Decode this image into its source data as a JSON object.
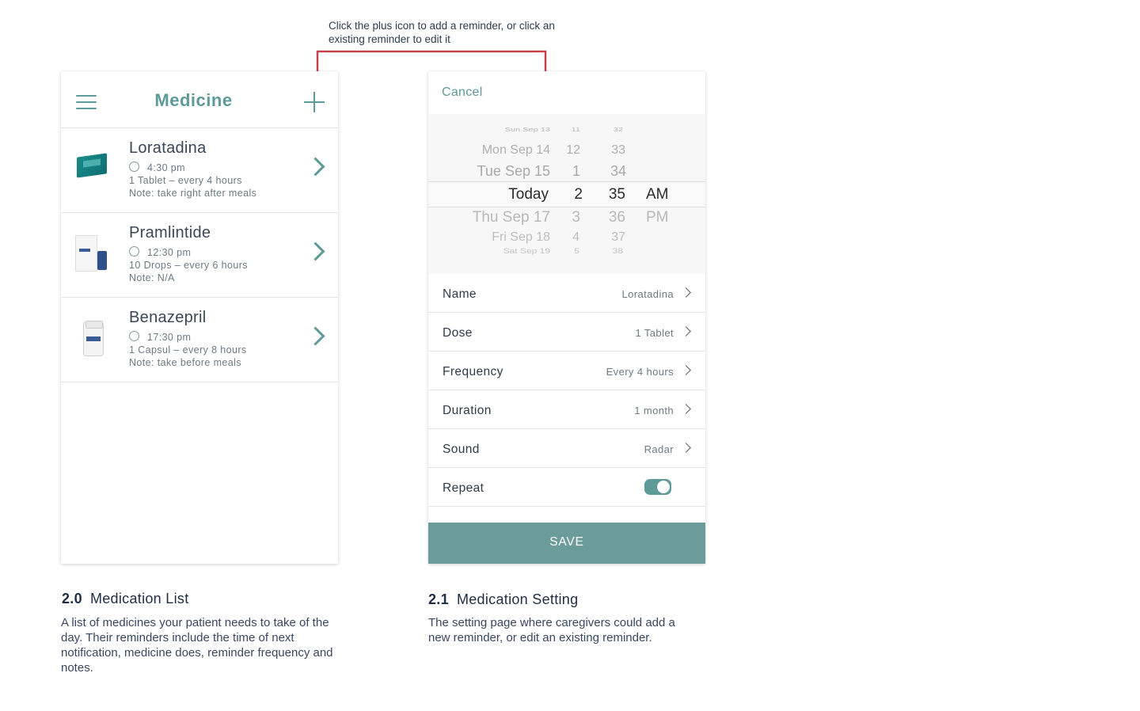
{
  "annotation": "Click the plus icon to add a reminder, or click an existing reminder to edit it",
  "list_screen": {
    "title": "Medicine",
    "medicines": [
      {
        "name": "Loratadina",
        "time": "4:30 pm",
        "dose": "1 Tablet – every 4 hours",
        "note": "Note: take right after meals",
        "icon": "blue-box-icon"
      },
      {
        "name": "Pramlintide",
        "time": "12:30 pm",
        "dose": "10 Drops – every 6 hours",
        "note": "Note: N/A",
        "icon": "box-and-vial-icon"
      },
      {
        "name": "Benazepril",
        "time": "17:30 pm",
        "dose": "1 Capsul – every 8 hours",
        "note": "Note: take before meals",
        "icon": "pill-bottle-icon"
      }
    ]
  },
  "setting_screen": {
    "cancel": "Cancel",
    "picker": {
      "dates": [
        "Sun Sep 13",
        "Mon Sep 14",
        "Tue Sep 15",
        "Today",
        "Thu Sep 17",
        "Fri Sep 18",
        "Sat Sep 19"
      ],
      "hours": [
        "11",
        "12",
        "1",
        "2",
        "3",
        "4",
        "5"
      ],
      "minutes": [
        "32",
        "33",
        "34",
        "35",
        "36",
        "37",
        "38"
      ],
      "ampm": [
        "AM",
        "PM"
      ],
      "selected": {
        "date": "Today",
        "hour": "2",
        "minute": "35",
        "ampm": "AM"
      }
    },
    "fields": [
      {
        "label": "Name",
        "value": "Loratadina"
      },
      {
        "label": "Dose",
        "value": "1 Tablet"
      },
      {
        "label": "Frequency",
        "value": "Every 4 hours"
      },
      {
        "label": "Duration",
        "value": "1 month"
      },
      {
        "label": "Sound",
        "value": "Radar"
      }
    ],
    "repeat": {
      "label": "Repeat",
      "on": true
    },
    "save": "SAVE"
  },
  "captions": [
    {
      "num": "2.0",
      "title": "Medication List",
      "text": "A list of medicines your patient needs to take of the day. Their reminders include the time of next notification, medicine does, reminder frequency and notes."
    },
    {
      "num": "2.1",
      "title": "Medication Setting",
      "text": "The setting page where caregivers could add a new reminder, or edit an existing reminder."
    }
  ],
  "colors": {
    "accent": "#5e9a97",
    "save_button": "#6b9c99",
    "arrow": "#c8424e"
  }
}
